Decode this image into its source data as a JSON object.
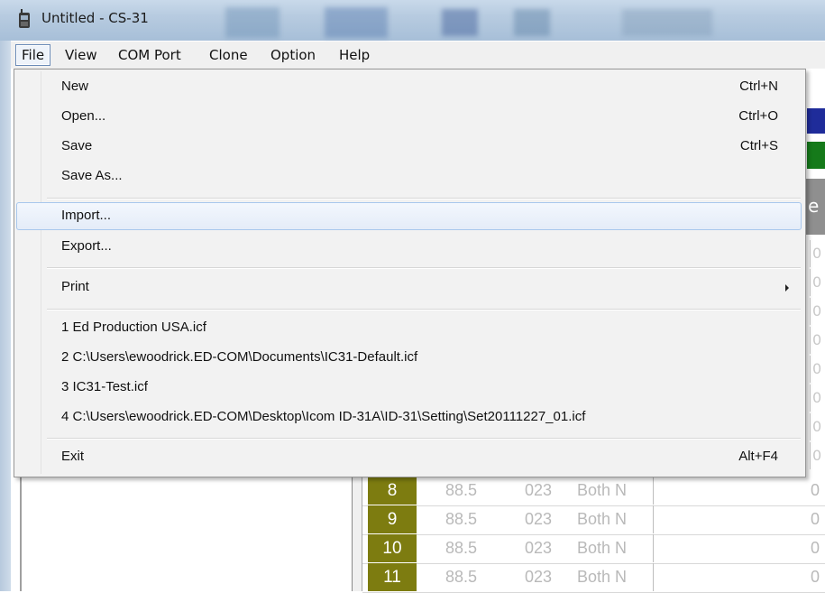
{
  "window": {
    "title": "Untitled - CS-31"
  },
  "menubar": {
    "items": [
      "File",
      "View",
      "COM Port",
      "Clone",
      "Option",
      "Help"
    ]
  },
  "file_menu": {
    "new": {
      "label": "New",
      "shortcut": "Ctrl+N"
    },
    "open": {
      "label": "Open...",
      "shortcut": "Ctrl+O"
    },
    "save": {
      "label": "Save",
      "shortcut": "Ctrl+S"
    },
    "save_as": {
      "label": "Save As..."
    },
    "import": {
      "label": "Import..."
    },
    "export": {
      "label": "Export..."
    },
    "print": {
      "label": "Print"
    },
    "recent": [
      "1 Ed Production USA.icf",
      "2 C:\\Users\\ewoodrick.ED-COM\\Documents\\IC31-Default.icf",
      "3 IC31-Test.icf",
      "4 C:\\Users\\ewoodrick.ED-COM\\Desktop\\Icom ID-31A\\ID-31\\Setting\\Set20111227_01.icf"
    ],
    "exit": {
      "label": "Exit",
      "shortcut": "Alt+F4"
    }
  },
  "grid": {
    "header_fragment": "e",
    "edge_values": [
      "0",
      "0",
      "0",
      "0",
      "0",
      "0",
      "0",
      "0"
    ],
    "rows": [
      {
        "num": "8",
        "tone": "88.5",
        "dtcs": "023",
        "pol": "Both N",
        "last": "0"
      },
      {
        "num": "9",
        "tone": "88.5",
        "dtcs": "023",
        "pol": "Both N",
        "last": "0"
      },
      {
        "num": "10",
        "tone": "88.5",
        "dtcs": "023",
        "pol": "Both N",
        "last": "0"
      },
      {
        "num": "11",
        "tone": "88.5",
        "dtcs": "023",
        "pol": "Both N",
        "last": "0"
      }
    ]
  },
  "colors": {
    "row_number_bg": "#7d7c10",
    "band_blue": "#1f2c9a",
    "band_green": "#157a1a"
  }
}
